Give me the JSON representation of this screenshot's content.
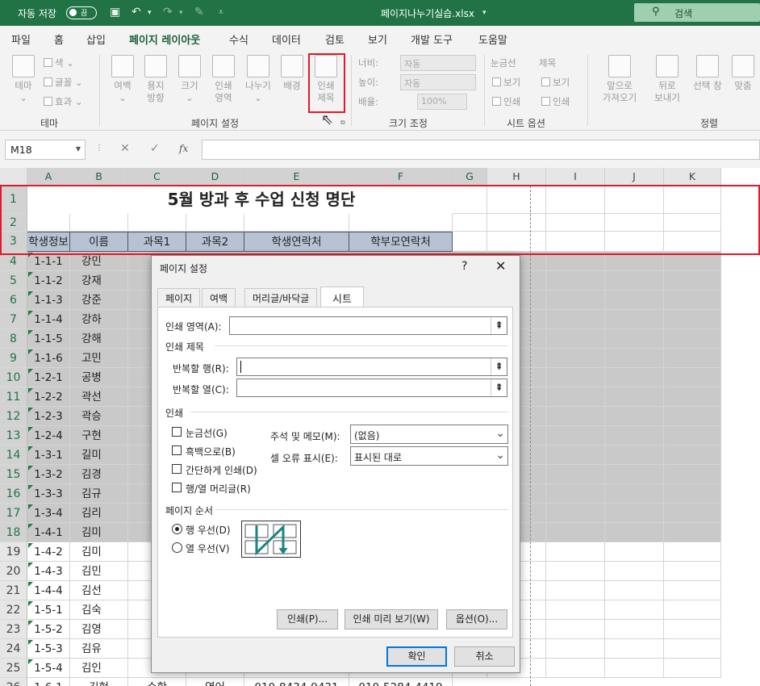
{
  "titlebar": {
    "autosave_label": "자동 저장",
    "autosave_state": "끔",
    "filename": "페이지나누기실습.xlsx",
    "search_placeholder": "검색"
  },
  "ribbon_tabs": [
    "파일",
    "홈",
    "삽입",
    "페이지 레이아웃",
    "수식",
    "데이터",
    "검토",
    "보기",
    "개발 도구",
    "도움말"
  ],
  "ribbon": {
    "theme": {
      "theme": "테마",
      "colors": "색",
      "fonts": "글꼴",
      "effects": "효과",
      "group": "테마"
    },
    "page_setup": {
      "margins": "여백",
      "orientation": "용지\n방향",
      "size": "크기",
      "print_area": "인쇄\n영역",
      "breaks": "나누기",
      "background": "배경",
      "print_titles": "인쇄\n제목",
      "group": "페이지 설정"
    },
    "scale": {
      "width": "너비:",
      "height": "높이:",
      "scale": "배율:",
      "width_val": "자동",
      "height_val": "자동",
      "scale_val": "100%",
      "group": "크기 조정"
    },
    "sheet_options": {
      "gridlines": "눈금선",
      "headings": "제목",
      "view": "보기",
      "print": "인쇄",
      "group": "시트 옵션"
    },
    "arrange": {
      "forward": "앞으로\n가져오기",
      "backward": "뒤로\n보내기",
      "selection": "선택 창",
      "align": "맞춤",
      "group": "정렬"
    }
  },
  "formula_bar": {
    "name_box": "M18",
    "fx": "fx"
  },
  "columns": [
    "A",
    "B",
    "C",
    "D",
    "E",
    "F",
    "G",
    "H",
    "I",
    "J",
    "K"
  ],
  "sheet": {
    "title": "5월 방과 후 수업 신청 명단",
    "headers": [
      "학생정보",
      "이름",
      "과목1",
      "과목2",
      "학생연락처",
      "학부모연락처"
    ],
    "rows": [
      [
        "1-1-1",
        "강민"
      ],
      [
        "1-1-2",
        "강재"
      ],
      [
        "1-1-3",
        "강준"
      ],
      [
        "1-1-4",
        "강하"
      ],
      [
        "1-1-5",
        "강해"
      ],
      [
        "1-1-6",
        "고민"
      ],
      [
        "1-2-1",
        "공병"
      ],
      [
        "1-2-2",
        "곽선"
      ],
      [
        "1-2-3",
        "곽승"
      ],
      [
        "1-2-4",
        "구현"
      ],
      [
        "1-3-1",
        "길미"
      ],
      [
        "1-3-2",
        "김경"
      ],
      [
        "1-3-3",
        "김규"
      ],
      [
        "1-3-4",
        "김리"
      ],
      [
        "1-4-1",
        "김미"
      ],
      [
        "1-4-2",
        "김미"
      ],
      [
        "1-4-3",
        "김민"
      ],
      [
        "1-4-4",
        "김선"
      ],
      [
        "1-5-1",
        "김숙"
      ],
      [
        "1-5-2",
        "김영"
      ],
      [
        "1-5-3",
        "김유"
      ],
      [
        "1-5-4",
        "김인"
      ]
    ],
    "last_row": [
      "1-6-1",
      "김현",
      "수학",
      "영어",
      "010-8434-9431",
      "010-5284-4419"
    ]
  },
  "dialog": {
    "title": "페이지 설정",
    "help": "?",
    "close": "✕",
    "tabs": [
      "페이지",
      "여백",
      "머리글/바닥글",
      "시트"
    ],
    "print_area_label": "인쇄 영역(A):",
    "print_titles_section": "인쇄 제목",
    "rows_repeat_label": "반복할 행(R):",
    "cols_repeat_label": "반복할 열(C):",
    "print_section": "인쇄",
    "gridlines": "눈금선(G)",
    "black_white": "흑백으로(B)",
    "draft": "간단하게 인쇄(D)",
    "headings": "행/열 머리글(R)",
    "comments_label": "주석 및 메모(M):",
    "comments_value": "(없음)",
    "errors_label": "셀 오류 표시(E):",
    "errors_value": "표시된 대로",
    "order_section": "페이지 순서",
    "down_then_over": "행 우선(D)",
    "over_then_down": "열 우선(V)",
    "print_btn": "인쇄(P)...",
    "preview_btn": "인쇄 미리 보기(W)",
    "options_btn": "옵션(O)...",
    "ok_btn": "확인",
    "cancel_btn": "취소"
  },
  "colors": {
    "excel_green": "#217346",
    "highlight_red": "#e0192b",
    "header_fill": "#b7c3d4"
  }
}
